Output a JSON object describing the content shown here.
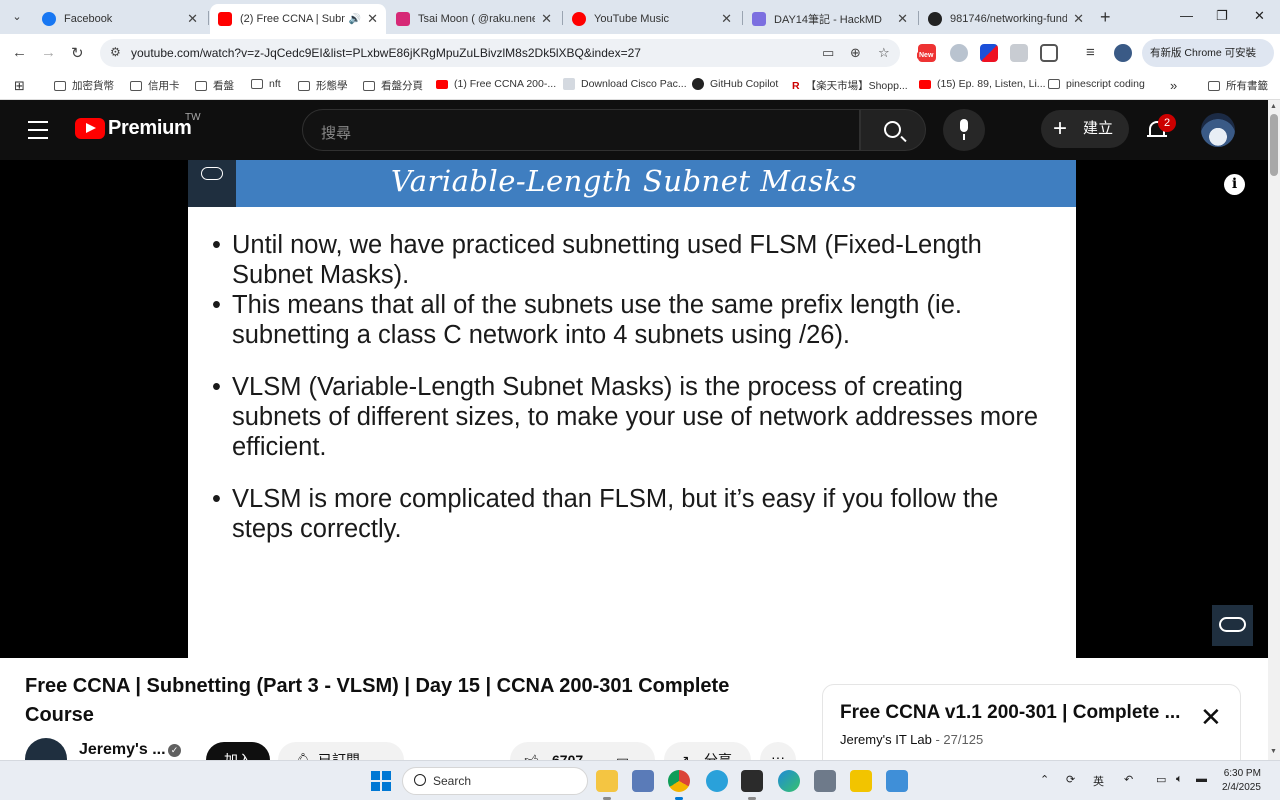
{
  "browser": {
    "tabs": [
      {
        "title": "Facebook",
        "active": false,
        "favicon_color": "#1877f2"
      },
      {
        "title": "(2) Free CCNA | Subnet",
        "active": true,
        "favicon_color": "#ff0000"
      },
      {
        "title": "Tsai Moon ( @raku.nene )",
        "active": false,
        "favicon_color": "#d62976"
      },
      {
        "title": "YouTube Music",
        "active": false,
        "favicon_color": "#ff0000"
      },
      {
        "title": "DAY14筆記 - HackMD",
        "active": false,
        "favicon_color": "#7c6fe0"
      },
      {
        "title": "981746/networking-funda",
        "active": false,
        "favicon_color": "#222222"
      }
    ],
    "url": "youtube.com/watch?v=z-JqCedc9EI&list=PLxbwE86jKRgMpuZuLBivzlM8s2Dk5lXBQ&index=27",
    "update_chip": "有新版 Chrome 可安裝",
    "bookmarks": [
      {
        "label": "加密貨幣",
        "icon": "folder"
      },
      {
        "label": "信用卡",
        "icon": "folder"
      },
      {
        "label": "看盤",
        "icon": "folder"
      },
      {
        "label": "nft",
        "icon": "folder"
      },
      {
        "label": "形態學",
        "icon": "folder"
      },
      {
        "label": "看盤分頁",
        "icon": "folder"
      },
      {
        "label": "(1) Free CCNA 200-...",
        "icon": "youtube"
      },
      {
        "label": "Download Cisco Pac...",
        "icon": "page"
      },
      {
        "label": "GitHub Copilot",
        "icon": "github"
      },
      {
        "label": "【楽天市場】Shopp...",
        "icon": "rakuten"
      },
      {
        "label": "(15) Ep. 89, Listen, Li...",
        "icon": "youtube"
      },
      {
        "label": "pinescript coding",
        "icon": "folder"
      }
    ],
    "bookmarks_all": "所有書籤",
    "ext_new_badge": "New"
  },
  "youtube": {
    "brand": "Premium",
    "region": "TW",
    "search_placeholder": "搜尋",
    "create_label": "建立",
    "notifications": "2"
  },
  "slide": {
    "title": "Variable-Length Subnet Masks",
    "logo_text": "Jeremy's IT Lab",
    "bullets": [
      "Until now, we have practiced subnetting used FLSM (Fixed-Length Subnet Masks).",
      "This means that all of the subnets use the same prefix length (ie. subnetting a class C network into 4 subnets using /26).",
      "VLSM (Variable-Length Subnet Masks) is the process of creating subnets of different sizes, to make your use of network addresses more efficient.",
      "VLSM is more complicated than FLSM, but it’s easy if you follow the steps correctly."
    ]
  },
  "video": {
    "title": "Free CCNA | Subnetting (Part 3 - VLSM) | Day 15 | CCNA 200-301 Complete Course",
    "channel": "Jeremy's ...",
    "join_label": "加入",
    "subscribed_label": "已訂閱",
    "likes": "6707",
    "share_label": "分享",
    "more_label": "···"
  },
  "playlist": {
    "title": "Free CCNA v1.1 200-301 | Complete ...",
    "channel": "Jeremy's IT Lab",
    "position": "27/125"
  },
  "taskbar": {
    "search_label": "Search",
    "ime": "英",
    "time": "6:30 PM",
    "date": "2/4/2025"
  }
}
